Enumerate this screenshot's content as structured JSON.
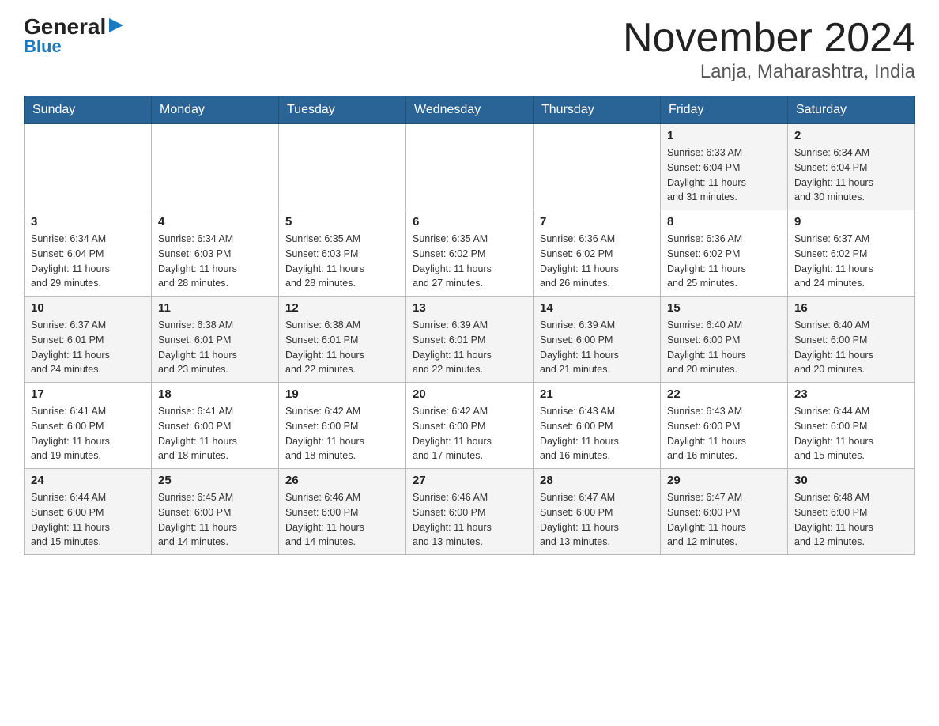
{
  "header": {
    "logo_main": "General",
    "logo_sub": "Blue",
    "title": "November 2024",
    "subtitle": "Lanja, Maharashtra, India"
  },
  "columns": [
    "Sunday",
    "Monday",
    "Tuesday",
    "Wednesday",
    "Thursday",
    "Friday",
    "Saturday"
  ],
  "weeks": [
    [
      {
        "day": "",
        "info": ""
      },
      {
        "day": "",
        "info": ""
      },
      {
        "day": "",
        "info": ""
      },
      {
        "day": "",
        "info": ""
      },
      {
        "day": "",
        "info": ""
      },
      {
        "day": "1",
        "info": "Sunrise: 6:33 AM\nSunset: 6:04 PM\nDaylight: 11 hours\nand 31 minutes."
      },
      {
        "day": "2",
        "info": "Sunrise: 6:34 AM\nSunset: 6:04 PM\nDaylight: 11 hours\nand 30 minutes."
      }
    ],
    [
      {
        "day": "3",
        "info": "Sunrise: 6:34 AM\nSunset: 6:04 PM\nDaylight: 11 hours\nand 29 minutes."
      },
      {
        "day": "4",
        "info": "Sunrise: 6:34 AM\nSunset: 6:03 PM\nDaylight: 11 hours\nand 28 minutes."
      },
      {
        "day": "5",
        "info": "Sunrise: 6:35 AM\nSunset: 6:03 PM\nDaylight: 11 hours\nand 28 minutes."
      },
      {
        "day": "6",
        "info": "Sunrise: 6:35 AM\nSunset: 6:02 PM\nDaylight: 11 hours\nand 27 minutes."
      },
      {
        "day": "7",
        "info": "Sunrise: 6:36 AM\nSunset: 6:02 PM\nDaylight: 11 hours\nand 26 minutes."
      },
      {
        "day": "8",
        "info": "Sunrise: 6:36 AM\nSunset: 6:02 PM\nDaylight: 11 hours\nand 25 minutes."
      },
      {
        "day": "9",
        "info": "Sunrise: 6:37 AM\nSunset: 6:02 PM\nDaylight: 11 hours\nand 24 minutes."
      }
    ],
    [
      {
        "day": "10",
        "info": "Sunrise: 6:37 AM\nSunset: 6:01 PM\nDaylight: 11 hours\nand 24 minutes."
      },
      {
        "day": "11",
        "info": "Sunrise: 6:38 AM\nSunset: 6:01 PM\nDaylight: 11 hours\nand 23 minutes."
      },
      {
        "day": "12",
        "info": "Sunrise: 6:38 AM\nSunset: 6:01 PM\nDaylight: 11 hours\nand 22 minutes."
      },
      {
        "day": "13",
        "info": "Sunrise: 6:39 AM\nSunset: 6:01 PM\nDaylight: 11 hours\nand 22 minutes."
      },
      {
        "day": "14",
        "info": "Sunrise: 6:39 AM\nSunset: 6:00 PM\nDaylight: 11 hours\nand 21 minutes."
      },
      {
        "day": "15",
        "info": "Sunrise: 6:40 AM\nSunset: 6:00 PM\nDaylight: 11 hours\nand 20 minutes."
      },
      {
        "day": "16",
        "info": "Sunrise: 6:40 AM\nSunset: 6:00 PM\nDaylight: 11 hours\nand 20 minutes."
      }
    ],
    [
      {
        "day": "17",
        "info": "Sunrise: 6:41 AM\nSunset: 6:00 PM\nDaylight: 11 hours\nand 19 minutes."
      },
      {
        "day": "18",
        "info": "Sunrise: 6:41 AM\nSunset: 6:00 PM\nDaylight: 11 hours\nand 18 minutes."
      },
      {
        "day": "19",
        "info": "Sunrise: 6:42 AM\nSunset: 6:00 PM\nDaylight: 11 hours\nand 18 minutes."
      },
      {
        "day": "20",
        "info": "Sunrise: 6:42 AM\nSunset: 6:00 PM\nDaylight: 11 hours\nand 17 minutes."
      },
      {
        "day": "21",
        "info": "Sunrise: 6:43 AM\nSunset: 6:00 PM\nDaylight: 11 hours\nand 16 minutes."
      },
      {
        "day": "22",
        "info": "Sunrise: 6:43 AM\nSunset: 6:00 PM\nDaylight: 11 hours\nand 16 minutes."
      },
      {
        "day": "23",
        "info": "Sunrise: 6:44 AM\nSunset: 6:00 PM\nDaylight: 11 hours\nand 15 minutes."
      }
    ],
    [
      {
        "day": "24",
        "info": "Sunrise: 6:44 AM\nSunset: 6:00 PM\nDaylight: 11 hours\nand 15 minutes."
      },
      {
        "day": "25",
        "info": "Sunrise: 6:45 AM\nSunset: 6:00 PM\nDaylight: 11 hours\nand 14 minutes."
      },
      {
        "day": "26",
        "info": "Sunrise: 6:46 AM\nSunset: 6:00 PM\nDaylight: 11 hours\nand 14 minutes."
      },
      {
        "day": "27",
        "info": "Sunrise: 6:46 AM\nSunset: 6:00 PM\nDaylight: 11 hours\nand 13 minutes."
      },
      {
        "day": "28",
        "info": "Sunrise: 6:47 AM\nSunset: 6:00 PM\nDaylight: 11 hours\nand 13 minutes."
      },
      {
        "day": "29",
        "info": "Sunrise: 6:47 AM\nSunset: 6:00 PM\nDaylight: 11 hours\nand 12 minutes."
      },
      {
        "day": "30",
        "info": "Sunrise: 6:48 AM\nSunset: 6:00 PM\nDaylight: 11 hours\nand 12 minutes."
      }
    ]
  ]
}
